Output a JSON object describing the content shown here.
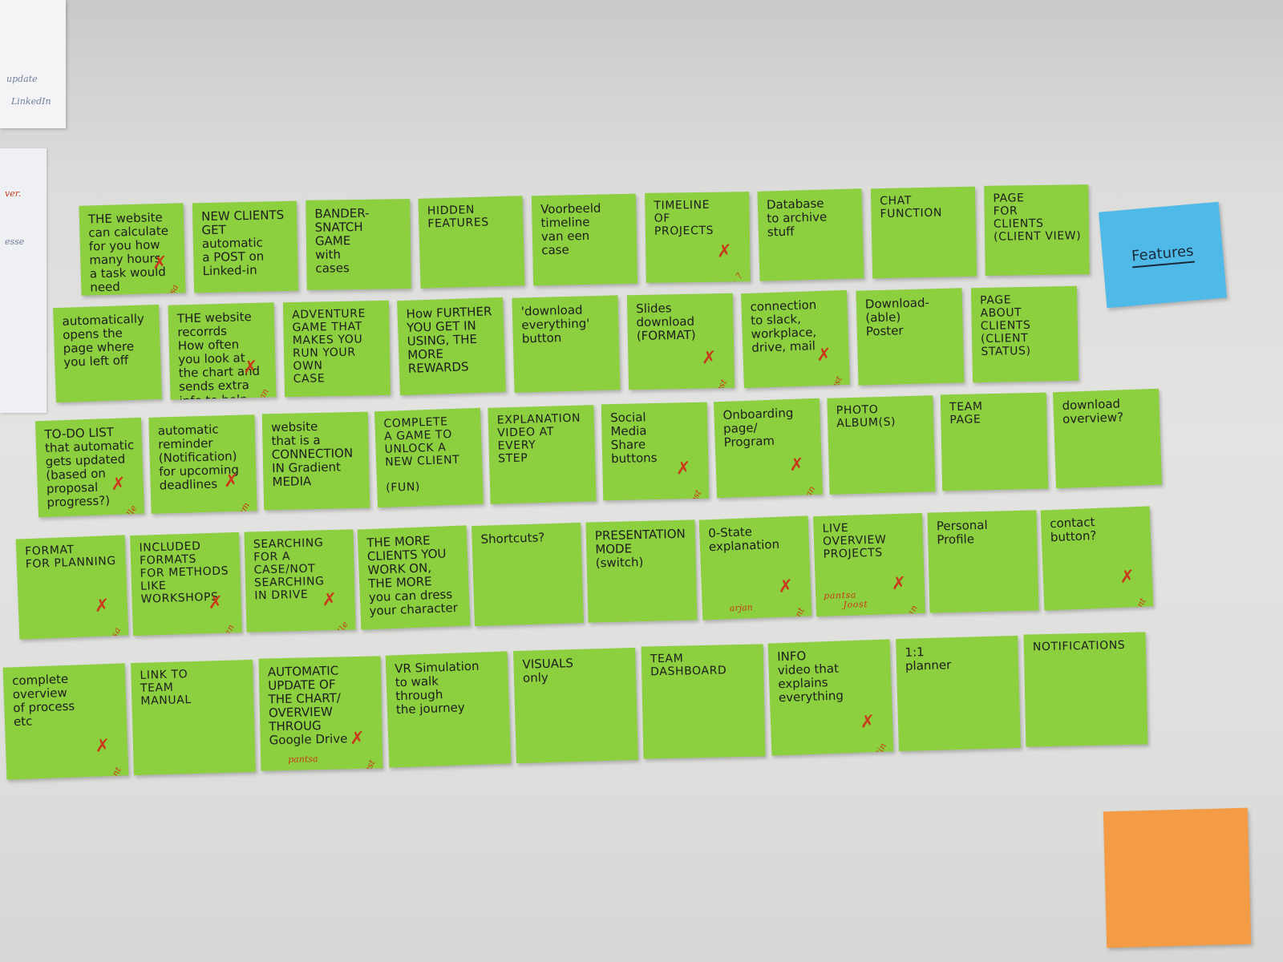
{
  "background_notes": {
    "scribbles": [
      "update",
      "LinkedIn",
      "ver.",
      "esse"
    ]
  },
  "feature_label": "Features",
  "note_color": "#8ccf3f",
  "marker_color": "#c83a1b",
  "feature_color": "#4fb9e8",
  "empty_note_color": "#f39c45",
  "notes": [
    {
      "text": "THE website\ncan calculate\nfor you how\nmany hours\na task would\nneed",
      "marks": [
        "pantsa"
      ],
      "x": true
    },
    {
      "text": "NEW CLIENTS\nGET automatic\na POST on\nLinked-in",
      "marks": [],
      "x": false
    },
    {
      "text": "BANDER-\nSNATCH\nGAME\nwith\ncases",
      "marks": [],
      "x": false
    },
    {
      "text": "HIDDEN\nFEATURES",
      "marks": [],
      "x": false
    },
    {
      "text": "Voorbeeld\ntimeline\nvan een\ncase",
      "marks": [],
      "x": false
    },
    {
      "text": "TIMELINE\nOF\nPROJECTS",
      "marks": [
        "elle ?"
      ],
      "x": true
    },
    {
      "text": "Database\nto archive\nstuff",
      "marks": [],
      "x": false
    },
    {
      "text": "CHAT\nFUNCTION",
      "marks": [],
      "x": false
    },
    {
      "text": "PAGE\nFOR\nCLIENTS\n(CLIENT VIEW)",
      "marks": [],
      "x": false
    },
    {
      "text": "automatically\nopens the\npage where\nyou left off",
      "marks": [],
      "x": false
    },
    {
      "text": "THE website\nrecorrds\nHow often\nyou look at\nthe chart and\nsends extra\ninfo to help\nexplain",
      "marks": [
        "arjan"
      ],
      "x": true
    },
    {
      "text": "ADVENTURE\nGAME THAT\nMAKES YOU\nRUN YOUR\nOWN\nCASE",
      "marks": [],
      "x": false
    },
    {
      "text": "How FURTHER\nYOU GET IN\nUSING, THE\nMORE\nREWARDS",
      "marks": [],
      "x": false
    },
    {
      "text": "'download\neverything'\nbutton",
      "marks": [],
      "x": false
    },
    {
      "text": "Slides\ndownload\n(FORMAT)",
      "marks": [
        "Joost"
      ],
      "x": true
    },
    {
      "text": "connection\nto slack,\nworkplace,\ndrive, mail",
      "marks": [
        "Joost"
      ],
      "x": true
    },
    {
      "text": "Download-\n(able)\nPoster",
      "marks": [],
      "x": false
    },
    {
      "text": "PAGE\nABOUT\nCLIENTS\n(CLIENT STATUS)",
      "marks": [],
      "x": false
    },
    {
      "text": "TO-DO LIST\nthat automatic\ngets updated\n(based on\nproposal\nprogress?)",
      "marks": [
        "elle"
      ],
      "x": true
    },
    {
      "text": "automatic\nreminder\n(Notification)\nfor upcoming\ndeadlines",
      "marks": [
        "Team"
      ],
      "x": true
    },
    {
      "text": "website\nthat is a\nCONNECTION\nIN Gradient\nMEDIA",
      "marks": [],
      "x": false
    },
    {
      "text": "COMPLETE\nA GAME TO\nUNLOCK A\nNEW CLIENT\n\n(FUN)",
      "marks": [],
      "x": false
    },
    {
      "text": "EXPLANATION\nVIDEO AT\nEVERY\nSTEP",
      "marks": [],
      "x": false
    },
    {
      "text": "Social\nMedia\nShare\nbuttons",
      "marks": [
        "Joost"
      ],
      "x": true
    },
    {
      "text": "Onboarding\npage/\nProgram",
      "marks": [
        "arjan"
      ],
      "x": true
    },
    {
      "text": "PHOTO\nALBUM(S)",
      "marks": [],
      "x": false
    },
    {
      "text": "TEAM\nPAGE",
      "marks": [],
      "x": false
    },
    {
      "text": "download\noverview?",
      "marks": [],
      "x": false
    },
    {
      "text": "FORMAT\nFOR PLANNING",
      "marks": [
        "pantsa"
      ],
      "x": true
    },
    {
      "text": "INCLUDED\nFORMATS\nFOR METHODS\nLIKE\nWORKSHOPS",
      "marks": [
        "arjan"
      ],
      "x": true
    },
    {
      "text": "SEARCHING\nFOR A\nCASE/NOT\nSEARCHING\nIN DRIVE",
      "marks": [
        "elle"
      ],
      "x": true
    },
    {
      "text": "THE MORE\nCLIENTS YOU\nWORK ON,\nTHE MORE\nyou can dress\nyour character",
      "marks": [],
      "x": false
    },
    {
      "text": "Shortcuts?",
      "marks": [],
      "x": false
    },
    {
      "text": "PRESENTATION\nMODE\n(switch)",
      "marks": [],
      "x": false
    },
    {
      "text": "0-State\nexplanation",
      "marks": [
        "klant",
        "arjan"
      ],
      "x": true
    },
    {
      "text": "LIVE\nOVERVIEW\nPROJECTS",
      "marks": [
        "arjan",
        "Joost",
        "pantsa"
      ],
      "x": true
    },
    {
      "text": "Personal\nProfile",
      "marks": [],
      "x": false
    },
    {
      "text": "contact\nbutton?",
      "marks": [
        "klant"
      ],
      "x": true
    },
    {
      "text": "complete\noverview\nof process\netc",
      "marks": [
        "klant"
      ],
      "x": true
    },
    {
      "text": "LINK TO\nTEAM\nMANUAL",
      "marks": [],
      "x": false
    },
    {
      "text": "AUTOMATIC\nUPDATE OF\nTHE CHART/\nOVERVIEW\nTHROUG\nGoogle Drive",
      "marks": [
        "Joost",
        "pantsa"
      ],
      "x": true
    },
    {
      "text": "VR Simulation\nto walk\nthrough\nthe journey",
      "marks": [],
      "x": false
    },
    {
      "text": "VISUALS\nonly",
      "marks": [],
      "x": false
    },
    {
      "text": "TEAM\nDASHBOARD",
      "marks": [],
      "x": false
    },
    {
      "text": "INFO\nvideo that\nexplains\neverything",
      "marks": [
        "Kerstin"
      ],
      "x": true
    },
    {
      "text": "1:1\nplanner",
      "marks": [],
      "x": false
    },
    {
      "text": "NOTIFICATIONS",
      "marks": [],
      "x": false
    }
  ]
}
